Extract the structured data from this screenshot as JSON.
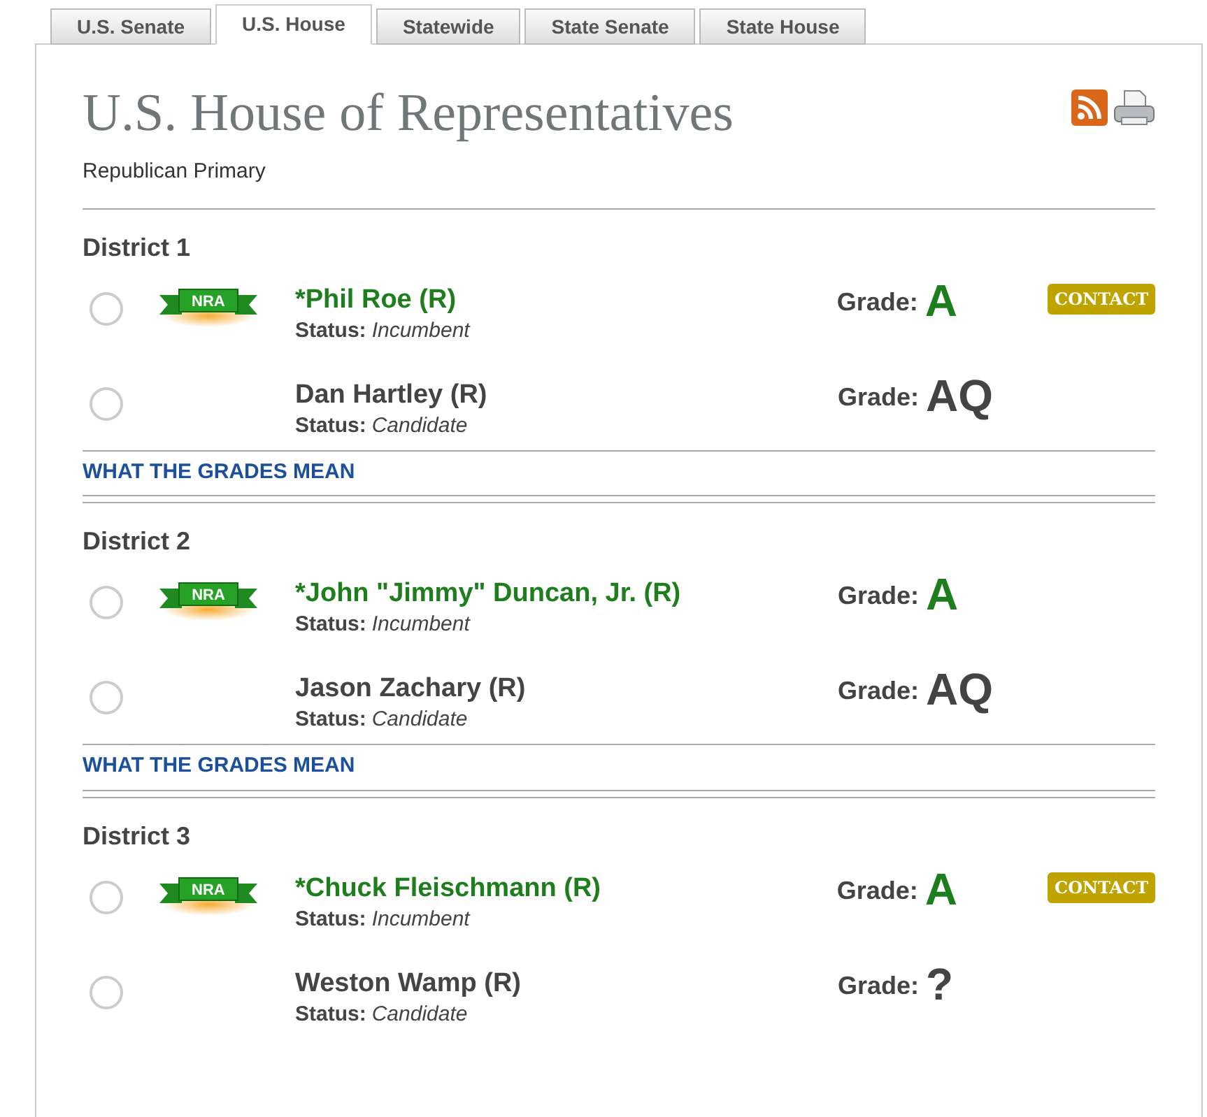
{
  "tabs": [
    {
      "label": "U.S. Senate",
      "selected": false
    },
    {
      "label": "U.S. House",
      "selected": true
    },
    {
      "label": "Statewide",
      "selected": false
    },
    {
      "label": "State Senate",
      "selected": false
    },
    {
      "label": "State House",
      "selected": false
    }
  ],
  "title": "U.S. House of Representatives",
  "subtitle": "Republican Primary",
  "districts": [
    {
      "name": "District 1",
      "grades_link": "WHAT THE GRADES MEAN",
      "candidates": [
        {
          "selected": false,
          "endorsed": true,
          "badge": "NRA",
          "name": "*Phil Roe (R)",
          "status_label": "Status:",
          "status": "Incumbent",
          "grade_label": "Grade:",
          "grade": "A",
          "contact": "CONTACT"
        },
        {
          "selected": false,
          "endorsed": false,
          "name": "Dan Hartley (R)",
          "status_label": "Status:",
          "status": "Candidate",
          "grade_label": "Grade:",
          "grade": "AQ"
        }
      ]
    },
    {
      "name": "District 2",
      "grades_link": "WHAT THE GRADES MEAN",
      "candidates": [
        {
          "selected": false,
          "endorsed": true,
          "badge": "NRA",
          "name": "*John \"Jimmy\" Duncan, Jr. (R)",
          "status_label": "Status:",
          "status": "Incumbent",
          "grade_label": "Grade:",
          "grade": "A"
        },
        {
          "selected": false,
          "endorsed": false,
          "name": "Jason Zachary (R)",
          "status_label": "Status:",
          "status": "Candidate",
          "grade_label": "Grade:",
          "grade": "AQ"
        }
      ]
    },
    {
      "name": "District 3",
      "candidates": [
        {
          "selected": false,
          "endorsed": true,
          "badge": "NRA",
          "name": "*Chuck Fleischmann (R)",
          "status_label": "Status:",
          "status": "Incumbent",
          "grade_label": "Grade:",
          "grade": "A",
          "contact": "CONTACT"
        },
        {
          "selected": false,
          "endorsed": false,
          "name": "Weston Wamp (R)",
          "status_label": "Status:",
          "status": "Candidate",
          "grade_label": "Grade:",
          "grade": "?"
        }
      ]
    }
  ]
}
